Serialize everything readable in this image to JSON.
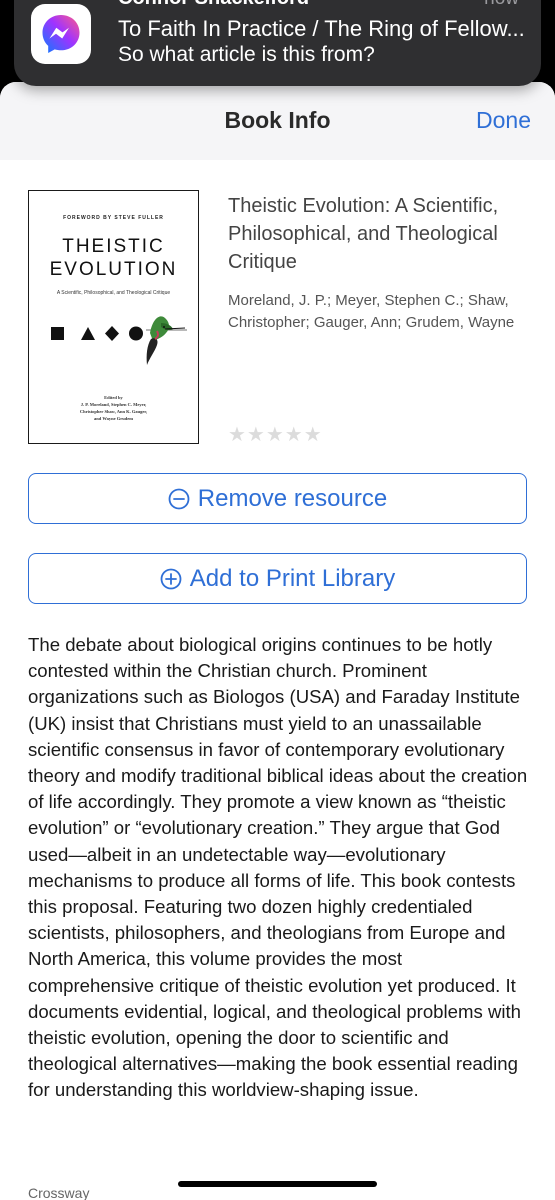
{
  "notification": {
    "app_icon": "messenger-icon",
    "sender": "Connor Shackelford",
    "time": "now",
    "title": "To Faith In Practice / The Ring of Fellow...",
    "body": "So what article is this from?"
  },
  "header": {
    "title": "Book Info",
    "done_label": "Done"
  },
  "book": {
    "cover": {
      "foreword": "FOREWORD BY STEVE FULLER",
      "title_line1": "THEISTIC",
      "title_line2": "EVOLUTION",
      "subtitle": "A Scientific, Philosophical, and Theological Critique",
      "edited_by": "Edited by",
      "editors_line1": "J. P. Moreland, Stephen C. Meyer,",
      "editors_line2": "Christopher Shaw, Ann K. Gauger,",
      "editors_line3": "and Wayne Grudem"
    },
    "title": "Theistic Evolution: A Scientific, Philosophical, and Theological Critique",
    "authors": "Moreland, J. P.; Meyer, Stephen C.; Shaw, Christopher; Gauger, Ann; Grudem, Wayne",
    "rating": 0,
    "rating_max": 5,
    "rating_stars": "★★★★★",
    "description": "The debate about biological origins continues to be hotly contested within the Christian church. Prominent organizations such as Biologos (USA) and Faraday Institute (UK) insist that Christians must yield to an unassailable scientific consensus in favor of contemporary evolutionary theory and modify traditional biblical ideas about the creation of life accordingly. They promote a view known as “theistic evolution” or “evolutionary creation.” They argue that God used—albeit in an undetectable way—evolutionary mechanisms to produce all forms of life. This book contests this proposal. Featuring two dozen highly credentialed scientists, philosophers, and theologians from Europe and North America, this volume provides the most comprehensive critique of theistic evolution yet produced. It documents evidential, logical, and theological problems with theistic evolution, opening the door to scientific and theological alternatives—making the book essential reading for understanding this worldview-shaping issue.",
    "publisher": "Crossway"
  },
  "actions": {
    "remove_label": "Remove resource",
    "remove_icon": "minus-circle-icon",
    "add_label": "Add to Print Library",
    "add_icon": "plus-circle-icon"
  },
  "colors": {
    "accent": "#2f6fd6",
    "notification_bg": "#2f2f31",
    "header_bg": "#f5f5f7"
  }
}
